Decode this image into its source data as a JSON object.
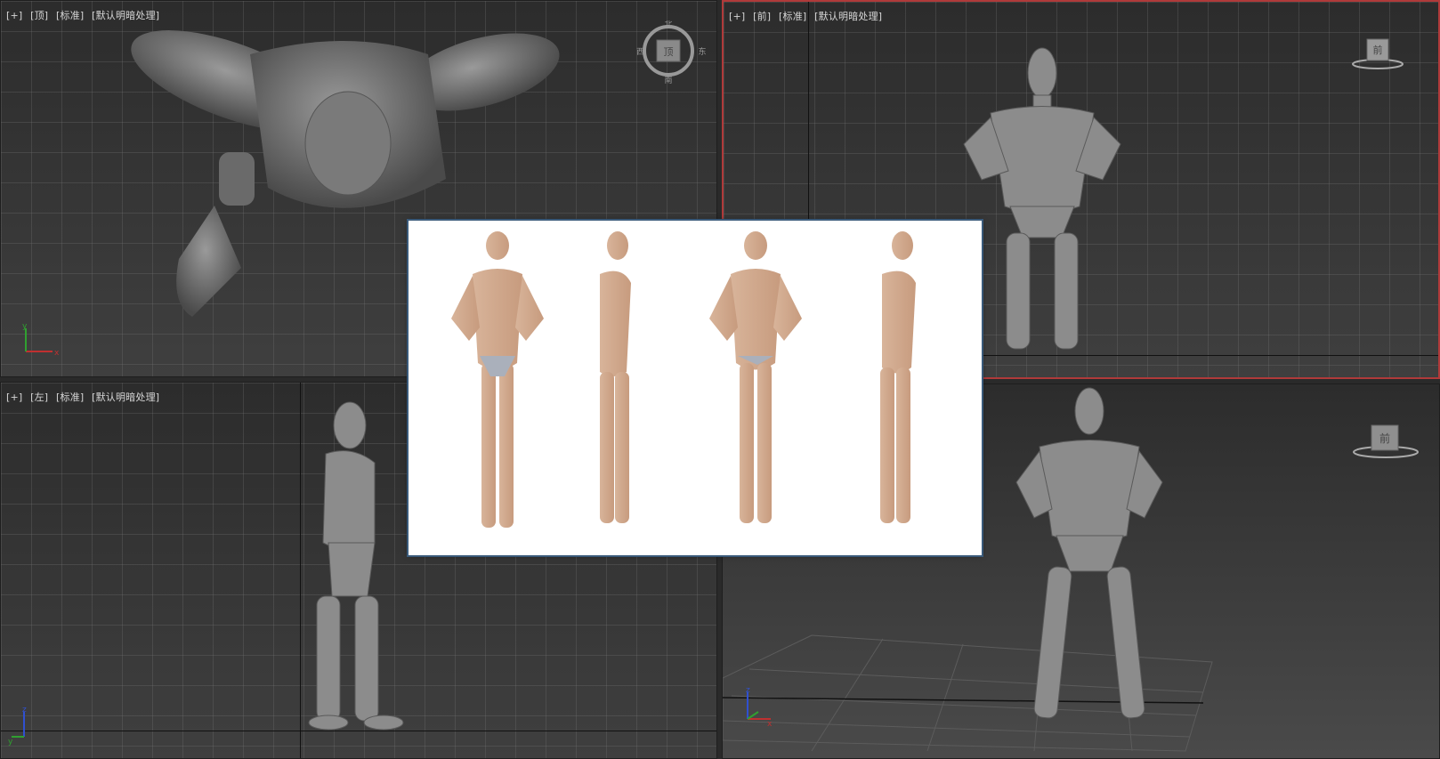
{
  "viewports": {
    "top": {
      "plus": "[+]",
      "view": "[顶]",
      "shading": "[标准]",
      "lighting": "[默认明暗处理]"
    },
    "front": {
      "plus": "[+]",
      "view": "[前]",
      "shading": "[标准]",
      "lighting": "[默认明暗处理]"
    },
    "left": {
      "plus": "[+]",
      "view": "[左]",
      "shading": "[标准]",
      "lighting": "[默认明暗处理]"
    },
    "perspective": {}
  },
  "viewcube": {
    "top": {
      "face": "顶",
      "north": "北",
      "south": "南",
      "east": "东",
      "west": "西"
    },
    "front": {
      "face": "前"
    },
    "perspective": {
      "face": "前"
    }
  },
  "axes": {
    "x": "x",
    "y": "y",
    "z": "z"
  },
  "colors": {
    "active_border": "#b03a3a",
    "axis_x": "#c03030",
    "axis_y": "#30a030",
    "axis_z": "#3050d0"
  }
}
